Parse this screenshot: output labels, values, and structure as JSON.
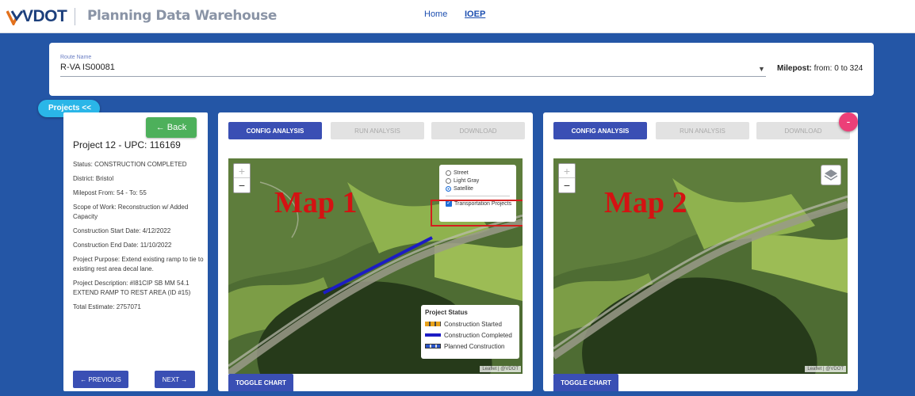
{
  "header": {
    "logo_text": "VDOT",
    "app_title": "Planning Data Warehouse",
    "nav": {
      "home": "Home",
      "ioep": "IOEP"
    }
  },
  "route": {
    "label": "Route Name",
    "value": "R-VA IS00081",
    "milepost_label": "Milepost:",
    "milepost_range": "from: 0 to 324"
  },
  "projects_tab": "Projects <<",
  "project": {
    "back_label": "← Back",
    "title": "Project 12 - UPC: 116169",
    "details": [
      "Status: CONSTRUCTION COMPLETED",
      "District: Bristol",
      "Milepost From: 54 - To: 55",
      "Scope of Work: Reconstruction w/ Added Capacity",
      "Construction Start Date: 4/12/2022",
      "Construction End Date: 11/10/2022",
      "Project Purpose: Extend existing ramp to tie to existing rest area decal lane.",
      "Project Description: #I81CIP SB MM 54.1 EXTEND RAMP TO REST AREA (ID #15)",
      "Total Estimate: 2757071"
    ],
    "prev_label": "← PREVIOUS",
    "next_label": "NEXT →"
  },
  "map1": {
    "config": "CONFIG ANALYSIS",
    "run": "RUN ANALYSIS",
    "download": "DOWNLOAD",
    "label": "Map 1",
    "basemaps": [
      {
        "label": "Street",
        "selected": false
      },
      {
        "label": "Light Gray",
        "selected": false
      },
      {
        "label": "Satellite",
        "selected": true
      }
    ],
    "layer_label": "Transportation Projects",
    "legend": {
      "title": "Project Status",
      "items": [
        "Construction Started",
        "Construction Completed",
        "Planned Construction"
      ]
    },
    "attribution": "Leaflet | @VDOT",
    "toggle": "TOGGLE CHART"
  },
  "map2": {
    "config": "CONFIG ANALYSIS",
    "run": "RUN ANALYSIS",
    "download": "DOWNLOAD",
    "label": "Map 2",
    "attribution": "Leaflet | @VDOT",
    "toggle": "TOGGLE CHART"
  },
  "fab_label": "-",
  "colors": {
    "page_bg": "#2456a6",
    "primary_button": "#3a4fb4",
    "back_button": "#4db05b",
    "map_label": "#d41212",
    "completed_line": "#1c1cc4"
  }
}
